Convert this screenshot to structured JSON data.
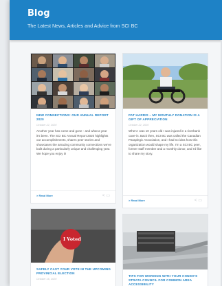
{
  "header": {
    "title": "Blog",
    "subtitle": "The Latest News, Articles and Advice from SCI BC"
  },
  "posts": [
    {
      "title": "New Connections: Our Annual Report 2020",
      "date": "October 22, 2020",
      "excerpt": "Another year has come and gone - and what a year it's been. The SCI BC Annual Report 2020 highlights our accomplishments, shares peer stories and showcases the amazing community connections we've built during a particularly unique and challenging year. We hope you enjoy it!",
      "read_more": "> Read More"
    },
    {
      "title": "Pat Harris – My Monthly Donation Is A Gift Of Appreciation",
      "date": "October 22, 2020",
      "excerpt": "When I was 10 years old I was injured in a riverbank cave-in. Back then, SCI BC was called the Canadian Paraplegic Association, and I had no idea how this organization would shape my life. I'm a SCI BC peer, former staff member and a monthly donor, and I'd like to share my story.",
      "read_more": "> Read More"
    },
    {
      "title": "Safely Cast Your Vote In The Upcoming Provincial Election",
      "date": "October 16, 2020",
      "image_text": "I Voted"
    },
    {
      "title": "Tips For Working With Your Condo's Strata Council For Common Area Accessibility"
    }
  ]
}
